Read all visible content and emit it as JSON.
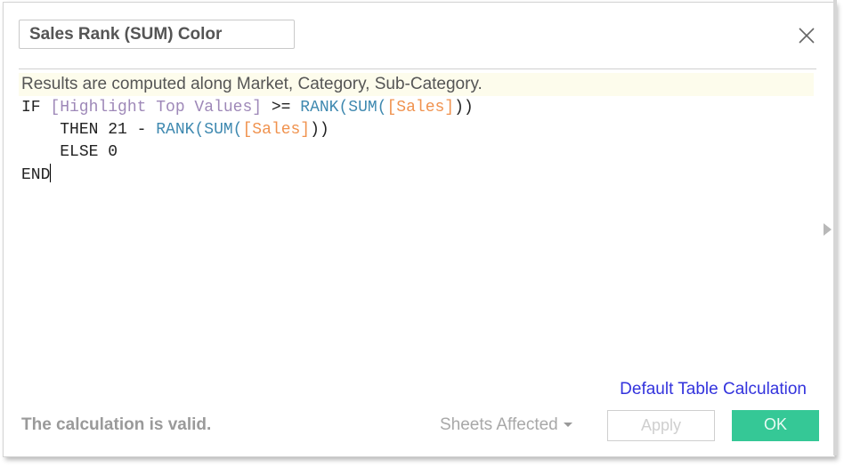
{
  "dialog": {
    "calc_name": "Sales Rank (SUM) Color",
    "close_icon": "close-icon",
    "info_message": "Results are computed along Market, Category, Sub-Category.",
    "formula": {
      "line1": {
        "kw": "IF ",
        "field": "[Highlight Top Values]",
        "op": " >= ",
        "fn1": "RANK(",
        "fn2": "SUM(",
        "ref": "[Sales]",
        "close": "))"
      },
      "line2": {
        "indent": "    ",
        "kw": "THEN 21 - ",
        "fn1": "RANK(",
        "fn2": "SUM(",
        "ref": "[Sales]",
        "close": "))"
      },
      "line3": {
        "indent": "    ",
        "kw": "ELSE 0"
      },
      "line4": {
        "kw": "END"
      }
    },
    "expand_arrow_icon": "triangle-right-icon",
    "default_table_calc_label": "Default Table Calculation",
    "status": "The calculation is valid.",
    "sheets_affected_label": "Sheets Affected",
    "apply_label": "Apply",
    "ok_label": "OK",
    "colors": {
      "ok": "#35c896",
      "link": "#3333dd",
      "field": "#9e88b8",
      "function": "#3f89b0",
      "reference": "#f0924e",
      "info_bar": "#fdfcec"
    }
  }
}
